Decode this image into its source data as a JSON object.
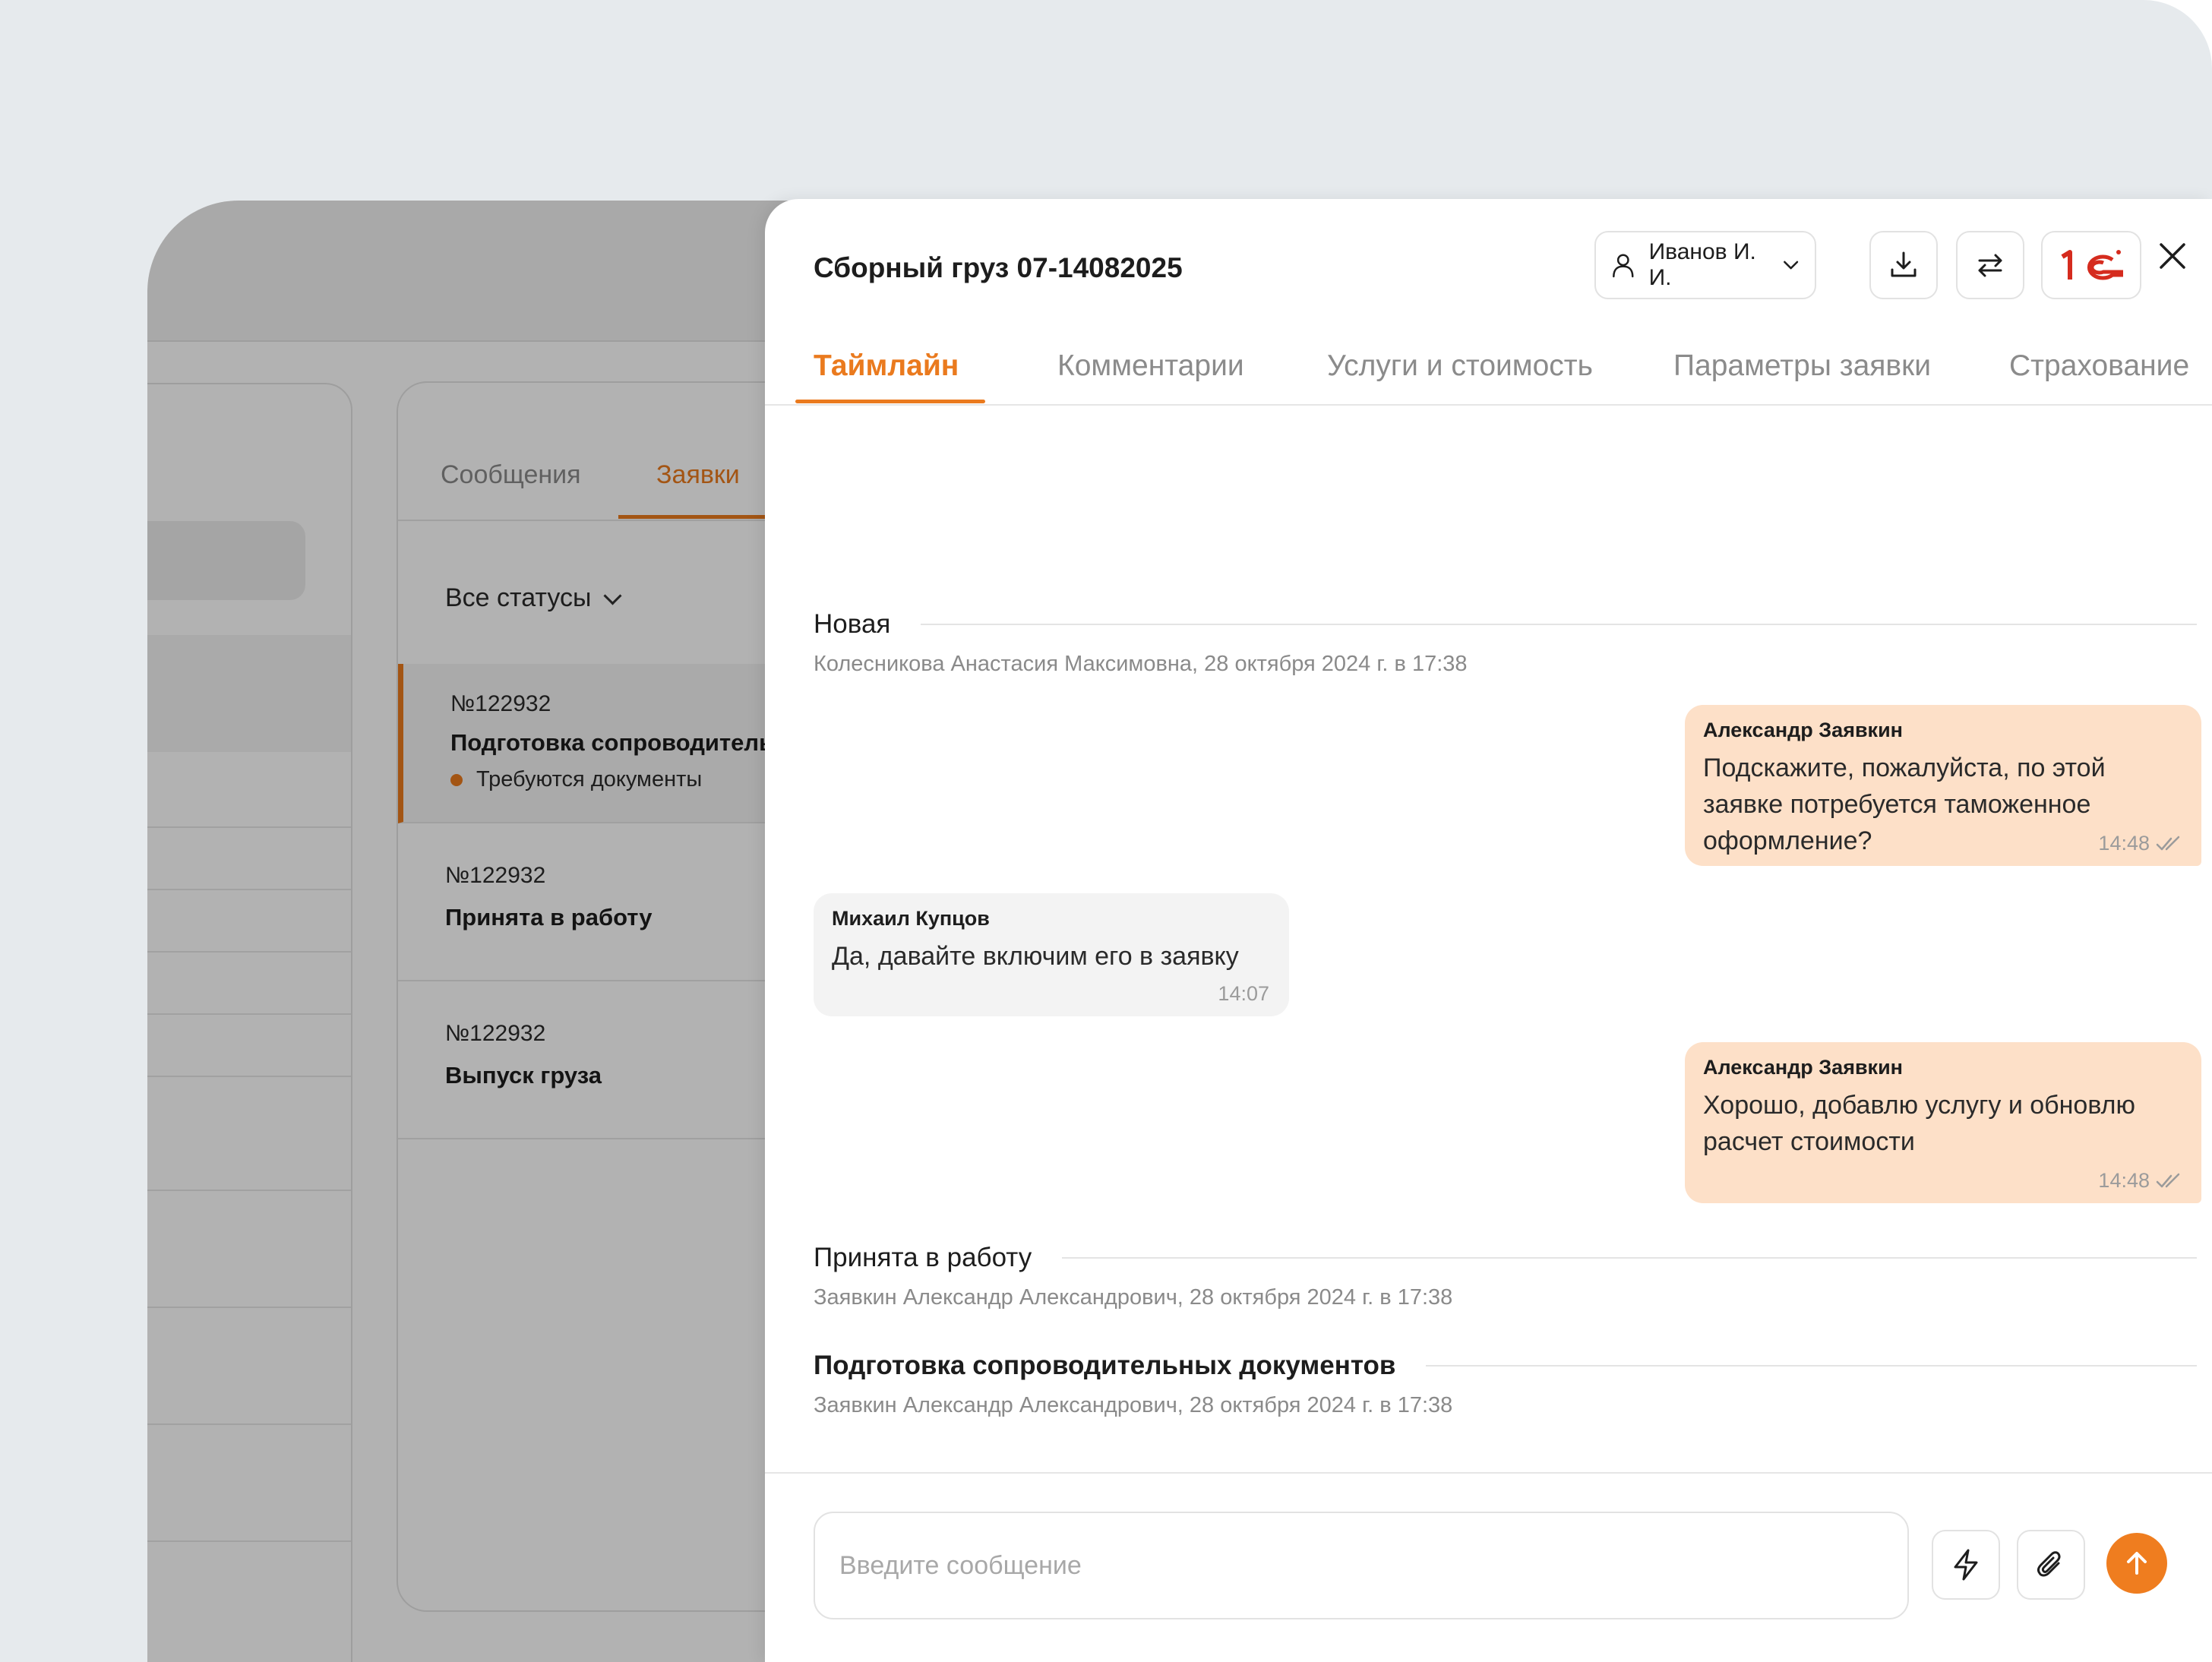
{
  "background_app": {
    "tabs": [
      {
        "label": "Сообщения"
      },
      {
        "label": "Заявки"
      }
    ],
    "status_filter": "Все статусы",
    "tickets": [
      {
        "number": "№122932",
        "title": "Подготовка сопроводительных документов",
        "flag": "Требуются документы"
      },
      {
        "number": "№122932",
        "title": "Принята в работу"
      },
      {
        "number": "№122932",
        "title": "Выпуск груза"
      }
    ]
  },
  "drawer": {
    "title": "Сборный груз 07-14082025",
    "user_selector": "Иванов И. И.",
    "tabs": [
      {
        "label": "Таймлайн"
      },
      {
        "label": "Комментарии"
      },
      {
        "label": "Услуги и стоимость"
      },
      {
        "label": "Параметры заявки"
      },
      {
        "label": "Страхование"
      }
    ],
    "timeline": {
      "status_new": {
        "label": "Новая",
        "meta": "Колесникова Анастасия Максимовна, 28 октября 2024 г. в 17:38"
      },
      "messages": [
        {
          "author": "Александр Заявкин",
          "text": "Подскажите, пожалуйста, по этой заявке потребуется таможенное оформление?",
          "time": "14:48"
        },
        {
          "author": "Михаил Купцов",
          "text": "Да, давайте включим его в заявку",
          "time": "14:07"
        },
        {
          "author": "Александр Заявкин",
          "text": "Хорошо, добавлю услугу и обновлю расчет стоимости",
          "time": "14:48"
        }
      ],
      "status_accepted": {
        "label": "Принята в работу",
        "meta": "Заявкин Александр Александрович, 28 октября 2024 г. в 17:38"
      },
      "status_docs": {
        "label": "Подготовка сопроводительных документов",
        "meta": "Заявкин Александр Александрович, 28 октября 2024 г. в 17:38"
      }
    },
    "composer": {
      "placeholder": "Введите сообщение"
    }
  },
  "colors": {
    "accent": "#ea7a1e",
    "outgoing_bubble": "#fde0c8",
    "incoming_bubble": "#f3f3f3",
    "onec_red": "#d52b1e"
  },
  "icons": [
    "user-icon",
    "chevron-down-icon",
    "download-icon",
    "swap-icon",
    "1c-logo",
    "close-icon",
    "double-check-icon",
    "lightning-icon",
    "paperclip-icon",
    "arrow-up-icon"
  ]
}
